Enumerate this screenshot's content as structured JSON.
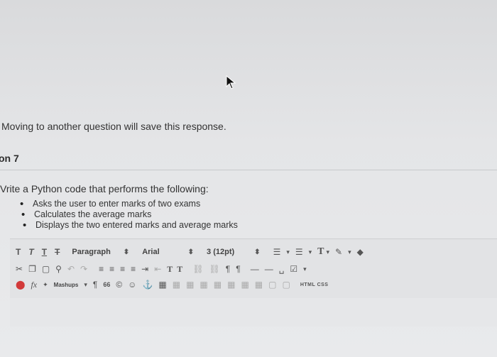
{
  "warning": "Moving to another question will save this response.",
  "question": {
    "number": "on 7",
    "prompt": "Vrite a Python code that performs the following:",
    "bullets": [
      "Asks the user to enter marks of two exams",
      "Calculates the average marks",
      "Displays the two entered marks and average marks"
    ]
  },
  "toolbar": {
    "row1": {
      "text_styles": [
        "T",
        "T",
        "T",
        "T"
      ],
      "paragraph": "Paragraph",
      "font": "Arial",
      "size": "3 (12pt)",
      "text_color_label": "T"
    },
    "row2": {
      "superscript": "T",
      "subscript": "T"
    },
    "row3": {
      "mashups": "Mashups",
      "paragraph_mark": "¶",
      "quote": "66",
      "html_css": "HTML CSS"
    }
  },
  "icons": {
    "cursor": "mouse-pointer-icon",
    "cut": "scissors-icon",
    "copy": "copy-icon",
    "paste": "paste-icon",
    "find": "search-icon",
    "undo": "undo-icon",
    "redo": "redo-icon",
    "spellcheck": "spellcheck-icon",
    "anchor": "anchor-icon",
    "table": "table-icon",
    "emoji": "smiley-icon"
  },
  "colors": {
    "accent_red": "#d23a3a",
    "background": "#e4e5e7"
  }
}
